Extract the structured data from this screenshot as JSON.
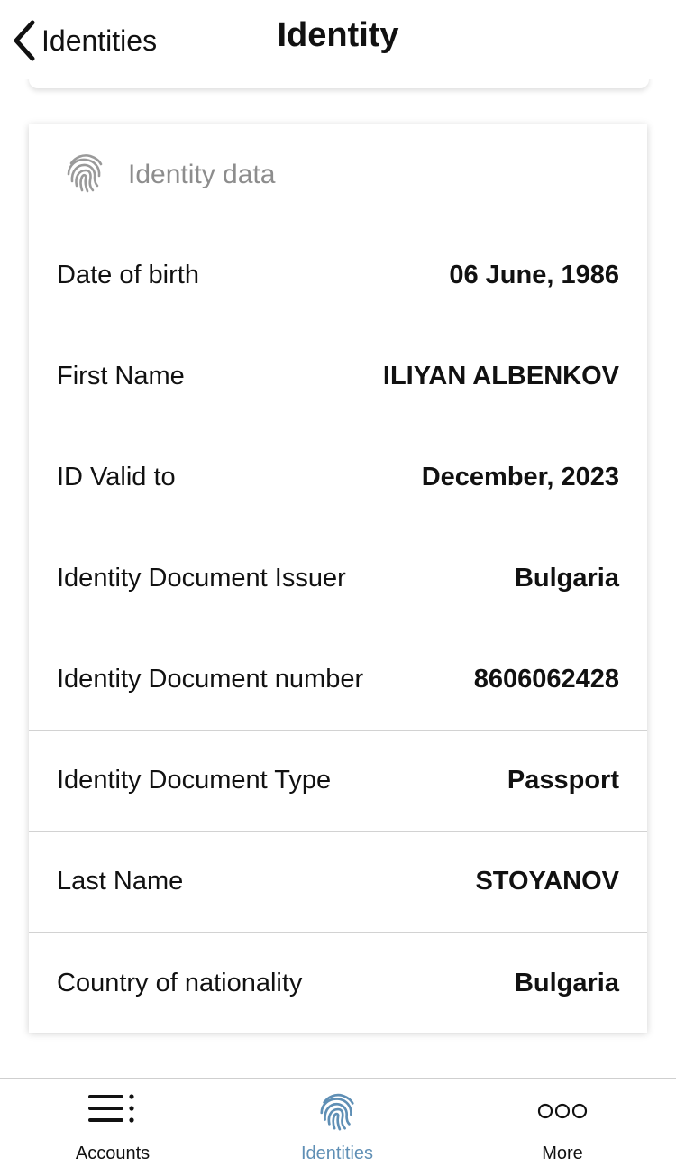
{
  "nav": {
    "back_label": "Identities",
    "title": "Identity",
    "back_icon": "chevron-left-icon"
  },
  "card": {
    "icon": "fingerprint-icon",
    "title": "Identity data",
    "rows": [
      {
        "label": "Date of birth",
        "value": "06 June, 1986"
      },
      {
        "label": "First Name",
        "value": "ILIYAN ALBENKOV"
      },
      {
        "label": "ID Valid to",
        "value": "December, 2023"
      },
      {
        "label": "Identity Document Issuer",
        "value": "Bulgaria"
      },
      {
        "label": "Identity Document number",
        "value": "8606062428"
      },
      {
        "label": "Identity Document Type",
        "value": "Passport"
      },
      {
        "label": "Last Name",
        "value": "STOYANOV"
      },
      {
        "label": "Country of nationality",
        "value": "Bulgaria"
      }
    ]
  },
  "tabbar": {
    "tabs": [
      {
        "label": "Accounts",
        "icon": "list-icon",
        "active": false
      },
      {
        "label": "Identities",
        "icon": "fingerprint-icon",
        "active": true
      },
      {
        "label": "More",
        "icon": "more-icon",
        "active": false
      }
    ]
  },
  "colors": {
    "active_tab": "#5f8fb5",
    "inactive_tab": "#111111",
    "card_title": "#8d8d8d",
    "divider": "#d2d2d2"
  }
}
